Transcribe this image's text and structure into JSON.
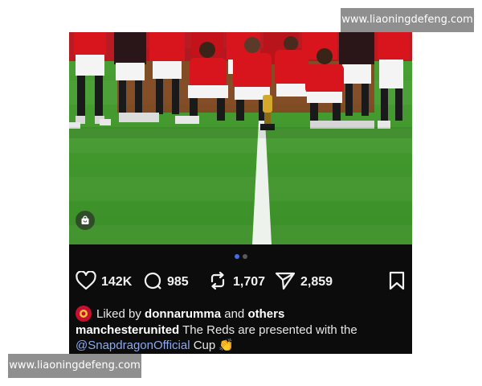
{
  "watermark": {
    "text": "www.liaoningdefeng.com"
  },
  "post": {
    "photo": {
      "icon": "shopping-bag-icon",
      "carousel": {
        "count": 2,
        "active_index": 0
      }
    },
    "actions": {
      "like": {
        "icon": "heart-icon",
        "count": "142K"
      },
      "comment": {
        "icon": "comment-icon",
        "count": "985"
      },
      "repost": {
        "icon": "repost-icon",
        "count": "1,707"
      },
      "share": {
        "icon": "send-icon",
        "count": "2,859"
      },
      "save": {
        "icon": "bookmark-icon"
      }
    },
    "liked_by": {
      "prefix": "Liked by",
      "user": "donnarumma",
      "joiner": "and",
      "others": "others"
    },
    "caption": {
      "author": "manchesterunited",
      "text": "The Reds are presented with the",
      "mention": "@SnapdragonOfficial",
      "text_after": "Cup",
      "emoji": "👏"
    }
  },
  "colors": {
    "post_bg": "#0c0c0d",
    "pitch": "#3f9a2a",
    "kit_red": "#d8141c",
    "mention": "#8da9ee",
    "dot_active": "#3d6fe0",
    "watermark_bg": "#8f8f8f"
  }
}
